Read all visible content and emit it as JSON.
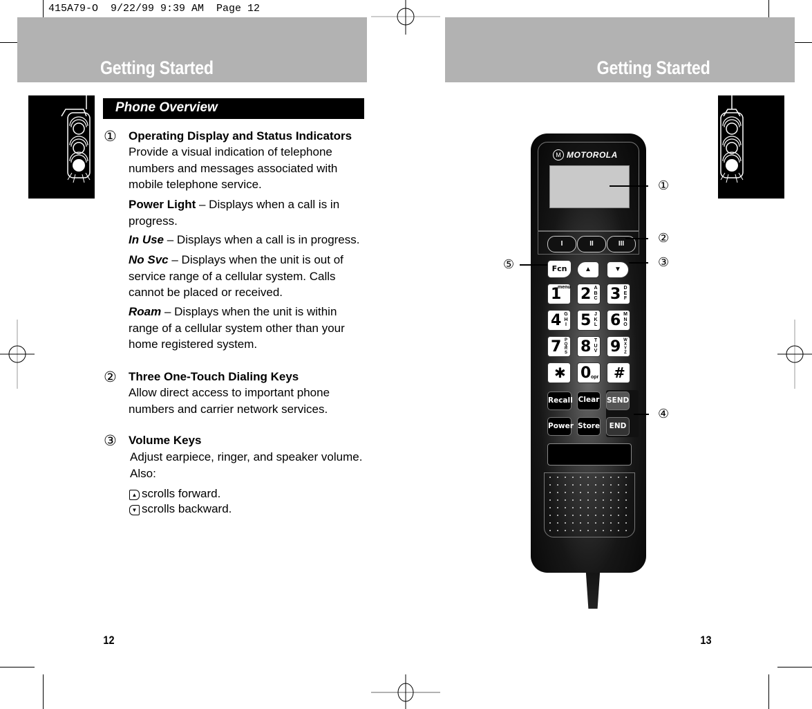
{
  "slug": "415A79-O  9/22/99 9:39 AM  Page 12",
  "left_page": {
    "header_title": "Getting Started",
    "section_title": "Phone Overview",
    "items": [
      {
        "number": "①",
        "title": "Operating Display and Status Indicators",
        "description": "Provide a visual indication of telephone numbers and messages associated with mobile telephone service.",
        "indicators": [
          {
            "term": "Power Light",
            "style": "bold",
            "text": " – Displays when a call is in progress."
          },
          {
            "term": "In Use",
            "style": "bold-italic",
            "text": " – Displays when a call is in progress."
          },
          {
            "term": "No Svc",
            "style": "bold-italic",
            "text": " – Displays when the unit is out of service range of a cellular system. Calls cannot be placed or received."
          },
          {
            "term": "Roam",
            "style": "bold-italic",
            "text": " – Displays when the unit is within range of a cellular system other than your home registered system."
          }
        ]
      },
      {
        "number": "②",
        "title": "Three One-Touch Dialing Keys",
        "description": "Allow direct access to important phone numbers and carrier network services."
      },
      {
        "number": "③",
        "title": "Volume Keys",
        "description": "Adjust earpiece, ringer, and speaker volume. Also:",
        "scroll_up": "scrolls forward.",
        "scroll_down": "scrolls backward."
      }
    ],
    "page_number": "12"
  },
  "right_page": {
    "header_title": "Getting Started",
    "page_number": "13",
    "phone": {
      "brand": "MOTOROLA",
      "one_touch_keys": [
        "I",
        "II",
        "III"
      ],
      "fcn_key": "Fcn",
      "up_glyph": "▲",
      "down_glyph": "▼",
      "keypad": [
        {
          "digit": "1",
          "letters": "menu"
        },
        {
          "digit": "2",
          "letters": "ABC"
        },
        {
          "digit": "3",
          "letters": "DEF"
        },
        {
          "digit": "4",
          "letters": "GHI"
        },
        {
          "digit": "5",
          "letters": "JKL"
        },
        {
          "digit": "6",
          "letters": "MNO"
        },
        {
          "digit": "7",
          "letters": "PQRS"
        },
        {
          "digit": "8",
          "letters": "TUV"
        },
        {
          "digit": "9",
          "letters": "WXYZ"
        },
        {
          "digit": "✱",
          "letters": ""
        },
        {
          "digit": "0",
          "letters": "opr"
        },
        {
          "digit": "#",
          "letters": ""
        }
      ],
      "function_keys": {
        "recall": "Recall",
        "clear": "Clear",
        "send": "SEND",
        "power": "Power",
        "store": "Store",
        "end": "END"
      }
    },
    "callouts": [
      "①",
      "②",
      "③",
      "④",
      "⑤"
    ]
  }
}
